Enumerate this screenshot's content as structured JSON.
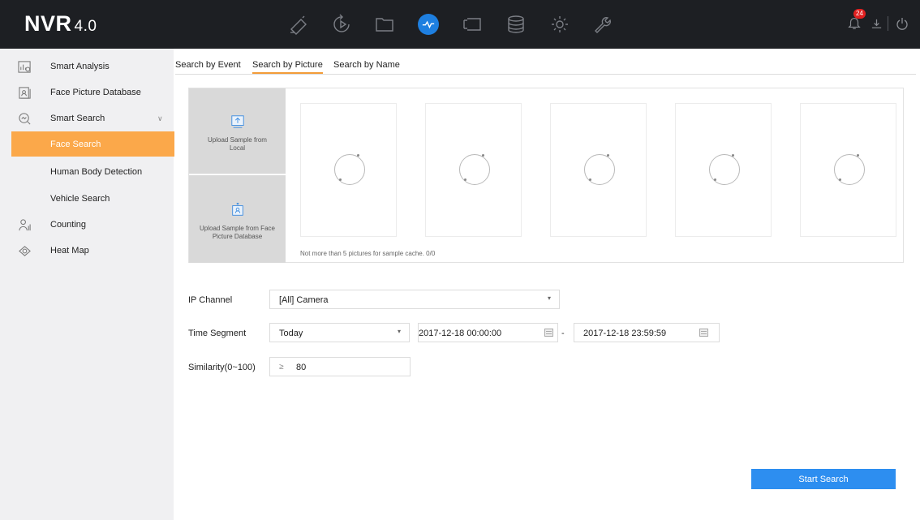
{
  "app": {
    "logo_main": "NVR",
    "logo_version": "4.0"
  },
  "topbar": {
    "nav_icons": [
      "live-view-icon",
      "playback-icon",
      "file-management-icon",
      "smart-analysis-icon",
      "configuration-icon",
      "storage-icon",
      "system-settings-icon",
      "maintenance-icon"
    ],
    "active_nav": "smart-analysis-icon",
    "alarm_count": "24",
    "accent_color": "#1e7fe0"
  },
  "sidebar": {
    "items": [
      {
        "label": "Smart Analysis",
        "icon": "smart-analysis-icon"
      },
      {
        "label": "Face Picture Database",
        "icon": "face-database-icon"
      },
      {
        "label": "Smart Search",
        "icon": "smart-search-icon"
      },
      {
        "label": "Face Search",
        "active": true
      },
      {
        "label": "Human Body Detection"
      },
      {
        "label": "Vehicle Search"
      },
      {
        "label": "Counting",
        "icon": "counting-icon"
      },
      {
        "label": "Heat Map",
        "icon": "heat-map-icon"
      }
    ],
    "active_color": "#fba84a"
  },
  "tabs": [
    {
      "label": "Search by Event"
    },
    {
      "label": "Search by Picture",
      "active": true
    },
    {
      "label": "Search by Name"
    }
  ],
  "upload": {
    "local_label": "Upload Sample from Local",
    "database_label": "Upload Sample from Face Picture Database",
    "cache_note": "Not more than 5 pictures for sample cache. 0/0",
    "slot_count": 5
  },
  "form": {
    "ip_channel_label": "IP Channel",
    "ip_channel_value": "[All] Camera",
    "time_segment_label": "Time Segment",
    "time_segment_value": "Today",
    "start_time": "2017-12-18 00:00:00",
    "end_time": "2017-12-18 23:59:59",
    "range_separator": "-",
    "similarity_label": "Similarity(0~100)",
    "similarity_operator": "≥",
    "similarity_value": "80"
  },
  "actions": {
    "start_search_label": "Start Search",
    "button_color": "#2d8ef0"
  }
}
